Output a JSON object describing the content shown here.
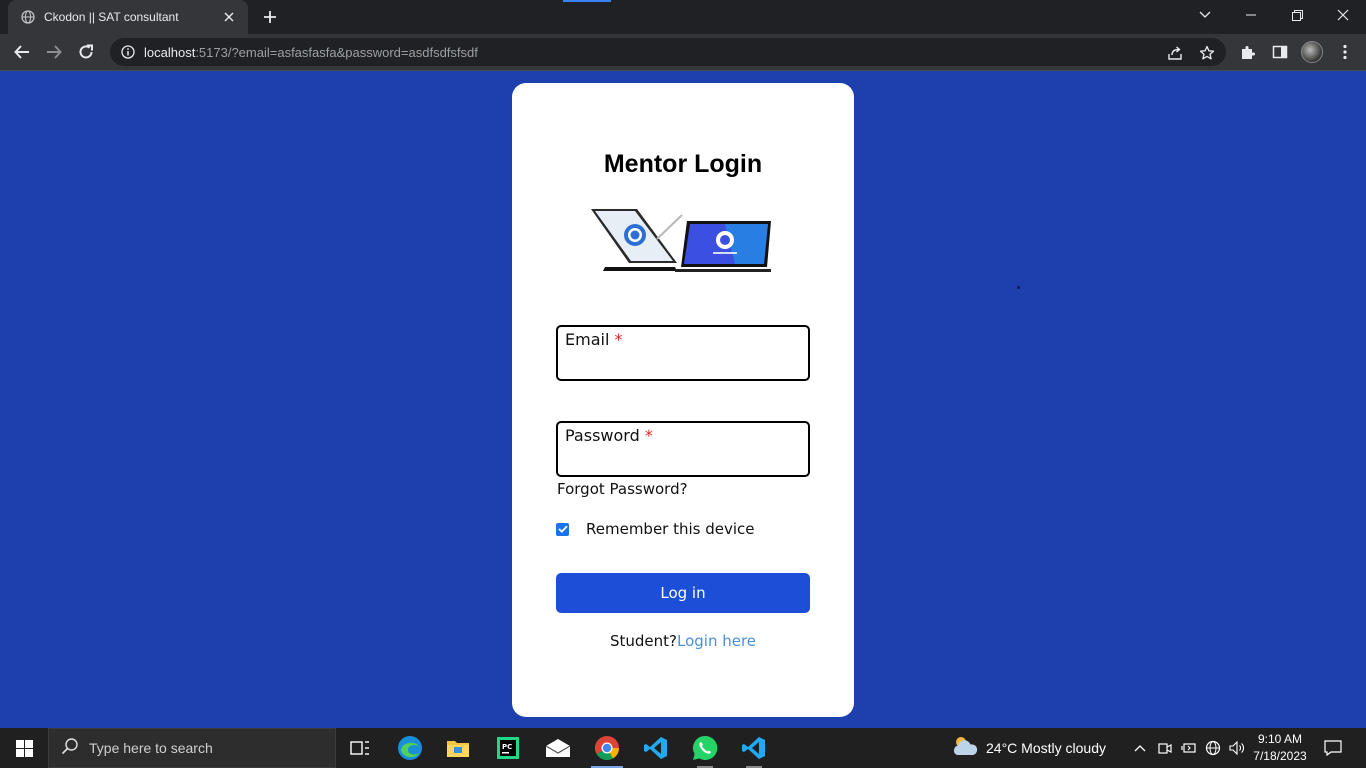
{
  "browser": {
    "tab_title": "Ckodon || SAT consultant",
    "url_host": "localhost",
    "url_rest": ":5173/?email=asfasfasfa&password=asdfsdfsfsdf"
  },
  "login": {
    "heading": "Mentor Login",
    "email_label": "Email",
    "password_label": "Password",
    "required_mark": "*",
    "forgot_password": "Forgot Password?",
    "remember_label": "Remember this device",
    "remember_checked": true,
    "submit_label": "Log in",
    "student_prefix": "Student?",
    "student_link": "Login here"
  },
  "taskbar": {
    "search_placeholder": "Type here to search",
    "weather": "24°C  Mostly cloudy",
    "time": "9:10 AM",
    "date": "7/18/2023"
  },
  "colors": {
    "page_background": "#1e40af",
    "login_button": "#1d4ed8",
    "link": "#4a90d9",
    "required": "#dc2626"
  }
}
